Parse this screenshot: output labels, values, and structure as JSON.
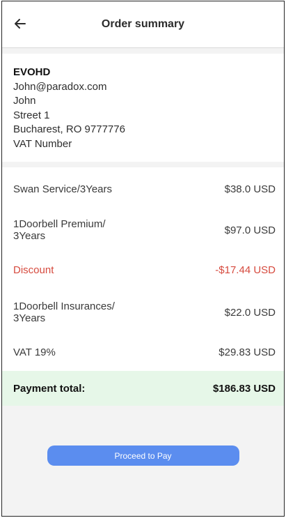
{
  "header": {
    "back_icon": "arrow-left-icon",
    "title": "Order summary"
  },
  "address": {
    "company": "EVOHD",
    "email": "John@paradox.com",
    "name": "John",
    "street": "Street 1",
    "city": "Bucharest, RO 9777776",
    "vat": "VAT Number"
  },
  "items": [
    {
      "label": "Swan Service/3Years",
      "value": "$38.0 USD"
    },
    {
      "label": "1Doorbell Premium/\n3Years",
      "value": "$97.0 USD"
    },
    {
      "label": "Discount",
      "value": "-$17.44 USD"
    },
    {
      "label": "1Doorbell Insurances/\n3Years",
      "value": "$22.0 USD"
    },
    {
      "label": "VAT 19%",
      "value": "$29.83 USD"
    }
  ],
  "total": {
    "label": "Payment total:",
    "value": "$186.83 USD"
  },
  "pay_button": {
    "label": "Proceed to Pay"
  },
  "colors": {
    "accent": "#5b8def",
    "discount": "#d64a3e",
    "total_bg": "#e6f7e8"
  }
}
